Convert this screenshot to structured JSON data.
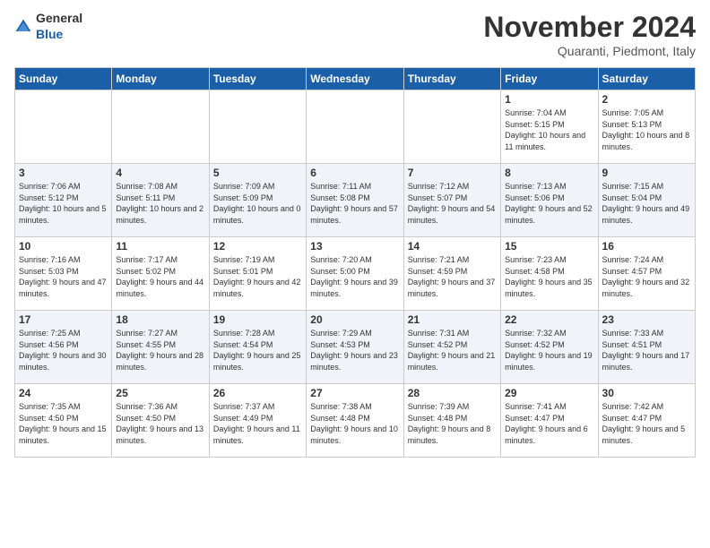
{
  "logo": {
    "general": "General",
    "blue": "Blue"
  },
  "title": "November 2024",
  "subtitle": "Quaranti, Piedmont, Italy",
  "days_of_week": [
    "Sunday",
    "Monday",
    "Tuesday",
    "Wednesday",
    "Thursday",
    "Friday",
    "Saturday"
  ],
  "weeks": [
    [
      {
        "day": "",
        "info": ""
      },
      {
        "day": "",
        "info": ""
      },
      {
        "day": "",
        "info": ""
      },
      {
        "day": "",
        "info": ""
      },
      {
        "day": "",
        "info": ""
      },
      {
        "day": "1",
        "info": "Sunrise: 7:04 AM\nSunset: 5:15 PM\nDaylight: 10 hours and 11 minutes."
      },
      {
        "day": "2",
        "info": "Sunrise: 7:05 AM\nSunset: 5:13 PM\nDaylight: 10 hours and 8 minutes."
      }
    ],
    [
      {
        "day": "3",
        "info": "Sunrise: 7:06 AM\nSunset: 5:12 PM\nDaylight: 10 hours and 5 minutes."
      },
      {
        "day": "4",
        "info": "Sunrise: 7:08 AM\nSunset: 5:11 PM\nDaylight: 10 hours and 2 minutes."
      },
      {
        "day": "5",
        "info": "Sunrise: 7:09 AM\nSunset: 5:09 PM\nDaylight: 10 hours and 0 minutes."
      },
      {
        "day": "6",
        "info": "Sunrise: 7:11 AM\nSunset: 5:08 PM\nDaylight: 9 hours and 57 minutes."
      },
      {
        "day": "7",
        "info": "Sunrise: 7:12 AM\nSunset: 5:07 PM\nDaylight: 9 hours and 54 minutes."
      },
      {
        "day": "8",
        "info": "Sunrise: 7:13 AM\nSunset: 5:06 PM\nDaylight: 9 hours and 52 minutes."
      },
      {
        "day": "9",
        "info": "Sunrise: 7:15 AM\nSunset: 5:04 PM\nDaylight: 9 hours and 49 minutes."
      }
    ],
    [
      {
        "day": "10",
        "info": "Sunrise: 7:16 AM\nSunset: 5:03 PM\nDaylight: 9 hours and 47 minutes."
      },
      {
        "day": "11",
        "info": "Sunrise: 7:17 AM\nSunset: 5:02 PM\nDaylight: 9 hours and 44 minutes."
      },
      {
        "day": "12",
        "info": "Sunrise: 7:19 AM\nSunset: 5:01 PM\nDaylight: 9 hours and 42 minutes."
      },
      {
        "day": "13",
        "info": "Sunrise: 7:20 AM\nSunset: 5:00 PM\nDaylight: 9 hours and 39 minutes."
      },
      {
        "day": "14",
        "info": "Sunrise: 7:21 AM\nSunset: 4:59 PM\nDaylight: 9 hours and 37 minutes."
      },
      {
        "day": "15",
        "info": "Sunrise: 7:23 AM\nSunset: 4:58 PM\nDaylight: 9 hours and 35 minutes."
      },
      {
        "day": "16",
        "info": "Sunrise: 7:24 AM\nSunset: 4:57 PM\nDaylight: 9 hours and 32 minutes."
      }
    ],
    [
      {
        "day": "17",
        "info": "Sunrise: 7:25 AM\nSunset: 4:56 PM\nDaylight: 9 hours and 30 minutes."
      },
      {
        "day": "18",
        "info": "Sunrise: 7:27 AM\nSunset: 4:55 PM\nDaylight: 9 hours and 28 minutes."
      },
      {
        "day": "19",
        "info": "Sunrise: 7:28 AM\nSunset: 4:54 PM\nDaylight: 9 hours and 25 minutes."
      },
      {
        "day": "20",
        "info": "Sunrise: 7:29 AM\nSunset: 4:53 PM\nDaylight: 9 hours and 23 minutes."
      },
      {
        "day": "21",
        "info": "Sunrise: 7:31 AM\nSunset: 4:52 PM\nDaylight: 9 hours and 21 minutes."
      },
      {
        "day": "22",
        "info": "Sunrise: 7:32 AM\nSunset: 4:52 PM\nDaylight: 9 hours and 19 minutes."
      },
      {
        "day": "23",
        "info": "Sunrise: 7:33 AM\nSunset: 4:51 PM\nDaylight: 9 hours and 17 minutes."
      }
    ],
    [
      {
        "day": "24",
        "info": "Sunrise: 7:35 AM\nSunset: 4:50 PM\nDaylight: 9 hours and 15 minutes."
      },
      {
        "day": "25",
        "info": "Sunrise: 7:36 AM\nSunset: 4:50 PM\nDaylight: 9 hours and 13 minutes."
      },
      {
        "day": "26",
        "info": "Sunrise: 7:37 AM\nSunset: 4:49 PM\nDaylight: 9 hours and 11 minutes."
      },
      {
        "day": "27",
        "info": "Sunrise: 7:38 AM\nSunset: 4:48 PM\nDaylight: 9 hours and 10 minutes."
      },
      {
        "day": "28",
        "info": "Sunrise: 7:39 AM\nSunset: 4:48 PM\nDaylight: 9 hours and 8 minutes."
      },
      {
        "day": "29",
        "info": "Sunrise: 7:41 AM\nSunset: 4:47 PM\nDaylight: 9 hours and 6 minutes."
      },
      {
        "day": "30",
        "info": "Sunrise: 7:42 AM\nSunset: 4:47 PM\nDaylight: 9 hours and 5 minutes."
      }
    ]
  ]
}
